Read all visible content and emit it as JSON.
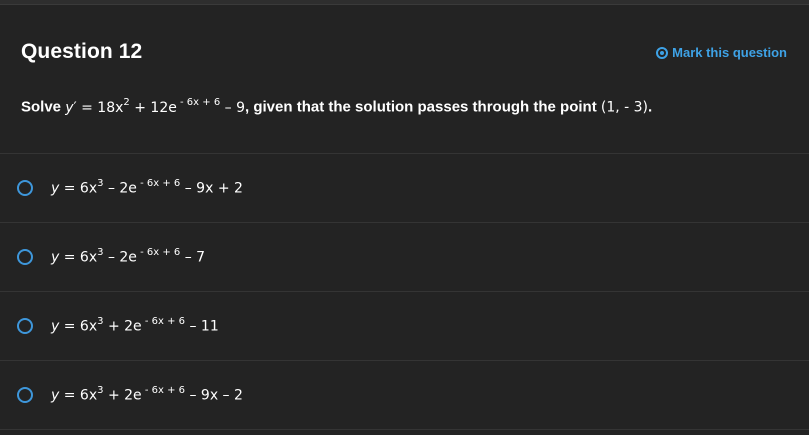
{
  "question": {
    "title": "Question 12",
    "mark_label": "Mark this question",
    "prompt": {
      "solve": "Solve ",
      "equation_y": "y",
      "equation_prime": "′",
      "equation_eq": " = 18x",
      "equation_sq": "2",
      "equation_mid": " + 12e",
      "equation_exp": " - 6x + 6",
      "equation_end": " – 9",
      "given_text": ", given that the solution passes through the point ",
      "point": "(1, - 3)",
      "period": "."
    }
  },
  "options": [
    {
      "y": "y",
      "lead": " = 6x",
      "cube": "3",
      "mid": " – 2e",
      "exp": " - 6x + 6",
      "tail": " – 9x + 2"
    },
    {
      "y": "y",
      "lead": " = 6x",
      "cube": "3",
      "mid": " – 2e",
      "exp": " - 6x + 6",
      "tail": " – 7"
    },
    {
      "y": "y",
      "lead": " = 6x",
      "cube": "3",
      "mid": " + 2e",
      "exp": " - 6x + 6",
      "tail": " – 11"
    },
    {
      "y": "y",
      "lead": " = 6x",
      "cube": "3",
      "mid": " + 2e",
      "exp": " - 6x + 6",
      "tail": " – 9x – 2"
    }
  ],
  "colors": {
    "background": "#232323",
    "accent": "#3ea2e6",
    "text": "#ffffff",
    "divider": "#343434"
  }
}
